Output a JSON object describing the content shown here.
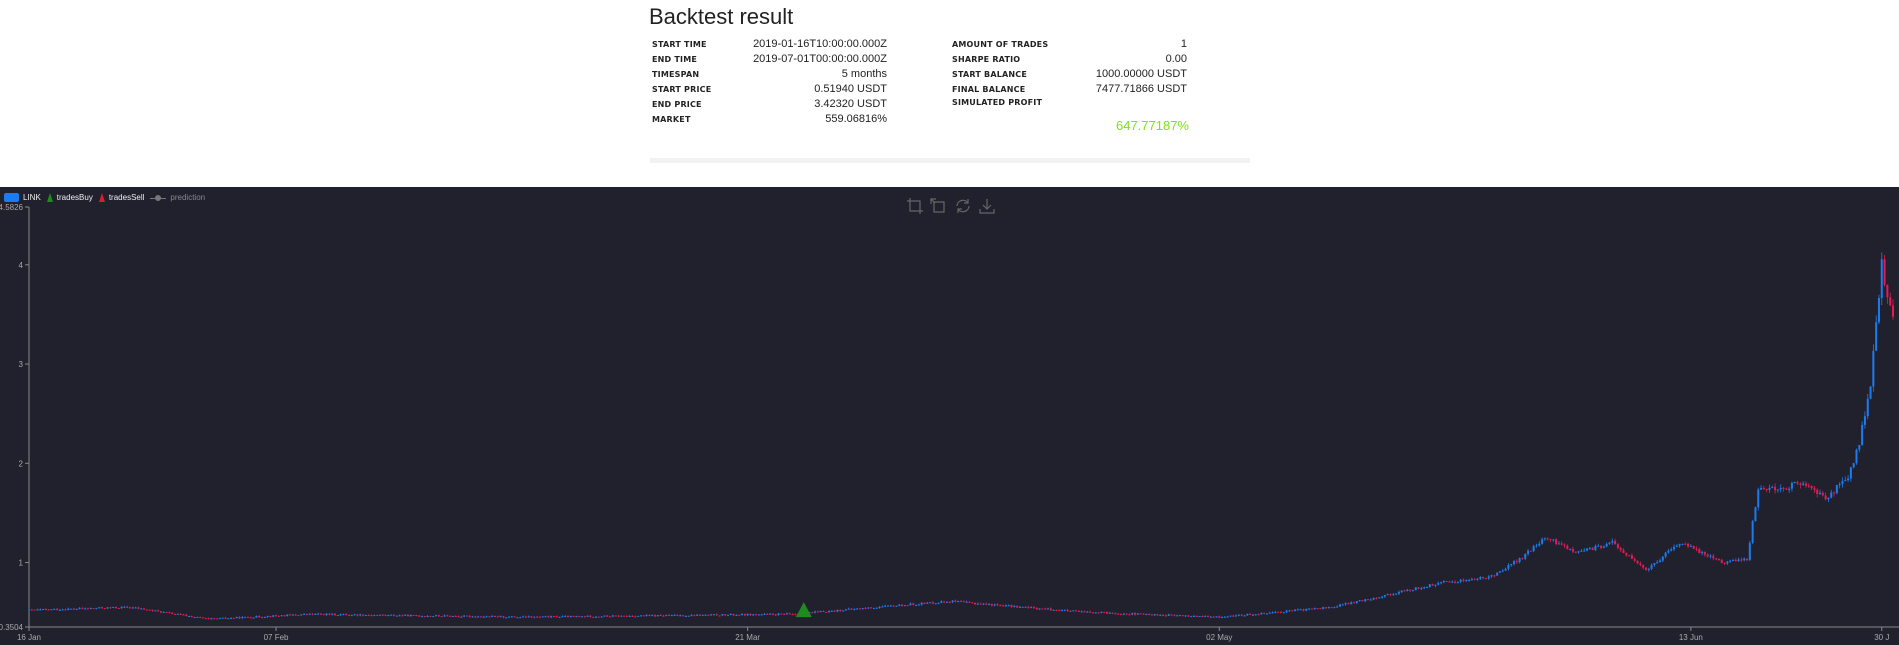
{
  "header": {
    "title": "Backtest result"
  },
  "stats_left": [
    {
      "label": "START TIME",
      "value": "2019-01-16T10:00:00.000Z"
    },
    {
      "label": "END TIME",
      "value": "2019-07-01T00:00:00.000Z"
    },
    {
      "label": "TIMESPAN",
      "value": "5 months"
    },
    {
      "label": "START PRICE",
      "value": "0.51940 USDT"
    },
    {
      "label": "END PRICE",
      "value": "3.42320 USDT"
    },
    {
      "label": "MARKET",
      "value": "559.06816%"
    }
  ],
  "stats_right": [
    {
      "label": "AMOUNT OF TRADES",
      "value": "1"
    },
    {
      "label": "SHARPE RATIO",
      "value": "0.00"
    },
    {
      "label": "START BALANCE",
      "value": "1000.00000 USDT"
    },
    {
      "label": "FINAL BALANCE",
      "value": "7477.71866 USDT"
    },
    {
      "label": "SIMULATED PROFIT",
      "value": ""
    }
  ],
  "profit": "647.77187%",
  "colors": {
    "profit": "#7fe21b",
    "up": "#1b7cf2",
    "down": "#e8194f",
    "buy": "#1f8b1f",
    "sell": "#e01b2b",
    "chart_bg": "#21202d"
  },
  "legend": {
    "series": "LINK",
    "buy": "tradesBuy",
    "sell": "tradesSell",
    "prediction": "prediction"
  },
  "toolbox": [
    "zoom-icon",
    "zoom-reset-icon",
    "restore-icon",
    "save-image-icon"
  ],
  "chart_data": {
    "type": "candlestick",
    "series_name": "LINK",
    "x_ticks": [
      "16 Jan",
      "07 Feb",
      "21 Mar",
      "02 May",
      "13 Jun",
      "30 J"
    ],
    "x_range": [
      "2019-01-16",
      "2019-07-01"
    ],
    "y_ticks": [
      "4.5826",
      "4",
      "3",
      "2",
      "1",
      "0.3504"
    ],
    "ylim": [
      0.3504,
      4.5826
    ],
    "anchors": [
      {
        "date": "2019-01-16",
        "close": 0.52
      },
      {
        "date": "2019-01-25",
        "close": 0.55
      },
      {
        "date": "2019-02-01",
        "close": 0.43
      },
      {
        "date": "2019-02-10",
        "close": 0.48
      },
      {
        "date": "2019-03-01",
        "close": 0.45
      },
      {
        "date": "2019-03-25",
        "close": 0.48
      },
      {
        "date": "2019-04-08",
        "close": 0.61
      },
      {
        "date": "2019-04-20",
        "close": 0.5
      },
      {
        "date": "2019-05-02",
        "close": 0.45
      },
      {
        "date": "2019-05-12",
        "close": 0.55
      },
      {
        "date": "2019-05-18",
        "close": 0.7
      },
      {
        "date": "2019-05-22",
        "close": 0.8
      },
      {
        "date": "2019-05-26",
        "close": 0.85
      },
      {
        "date": "2019-05-29",
        "close": 1.05
      },
      {
        "date": "2019-05-31",
        "close": 1.25
      },
      {
        "date": "2019-06-03",
        "close": 1.1
      },
      {
        "date": "2019-06-06",
        "close": 1.2
      },
      {
        "date": "2019-06-09",
        "close": 0.92
      },
      {
        "date": "2019-06-12",
        "close": 1.2
      },
      {
        "date": "2019-06-16",
        "close": 1.0
      },
      {
        "date": "2019-06-18",
        "close": 1.04
      },
      {
        "date": "2019-06-19",
        "close": 1.75
      },
      {
        "date": "2019-06-21",
        "close": 1.75
      },
      {
        "date": "2019-06-23",
        "close": 1.8
      },
      {
        "date": "2019-06-25",
        "close": 1.65
      },
      {
        "date": "2019-06-27",
        "close": 1.85
      },
      {
        "date": "2019-06-28",
        "close": 2.2
      },
      {
        "date": "2019-06-29",
        "close": 2.8
      },
      {
        "date": "2019-06-30",
        "close": 4.0
      },
      {
        "date": "2019-07-01",
        "close": 3.42
      }
    ],
    "trades": [
      {
        "type": "buy",
        "date": "2019-03-26",
        "price": 0.52
      }
    ]
  }
}
